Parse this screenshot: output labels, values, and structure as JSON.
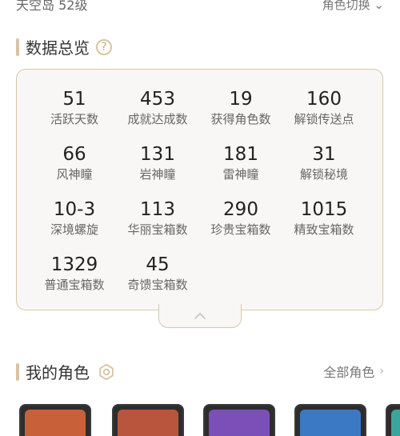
{
  "top": {
    "left_text": "天空岛 52级",
    "right_text": "角色切换 ⌄"
  },
  "overview": {
    "title": "数据总览",
    "help_icon": "?",
    "rows": [
      [
        {
          "value": "51",
          "label": "活跃天数"
        },
        {
          "value": "453",
          "label": "成就达成数"
        },
        {
          "value": "19",
          "label": "获得角色数"
        },
        {
          "value": "160",
          "label": "解锁传送点"
        }
      ],
      [
        {
          "value": "66",
          "label": "风神瞳"
        },
        {
          "value": "131",
          "label": "岩神瞳"
        },
        {
          "value": "181",
          "label": "雷神瞳"
        },
        {
          "value": "31",
          "label": "解锁秘境"
        }
      ],
      [
        {
          "value": "10-3",
          "label": "深境螺旋"
        },
        {
          "value": "113",
          "label": "华丽宝箱数"
        },
        {
          "value": "290",
          "label": "珍贵宝箱数"
        },
        {
          "value": "1015",
          "label": "精致宝箱数"
        }
      ],
      [
        {
          "value": "1329",
          "label": "普通宝箱数"
        },
        {
          "value": "45",
          "label": "奇馈宝箱数"
        }
      ]
    ]
  },
  "my_roles": {
    "title": "我的角色",
    "all_link": "全部角色",
    "chevron": "›"
  },
  "colors": {
    "accent": "#d8c3a0",
    "card_bg": "#f8f7f5",
    "card_border": "#d9c8aa",
    "char_1": "#c8603a",
    "char_2": "#b9553d",
    "char_3": "#7a4fb8",
    "char_4": "#3b79c4",
    "char_5": "#3aa59a"
  },
  "icons": [
    "help-icon",
    "chevron-up-icon",
    "settings-icon",
    "chevron-right-icon"
  ]
}
